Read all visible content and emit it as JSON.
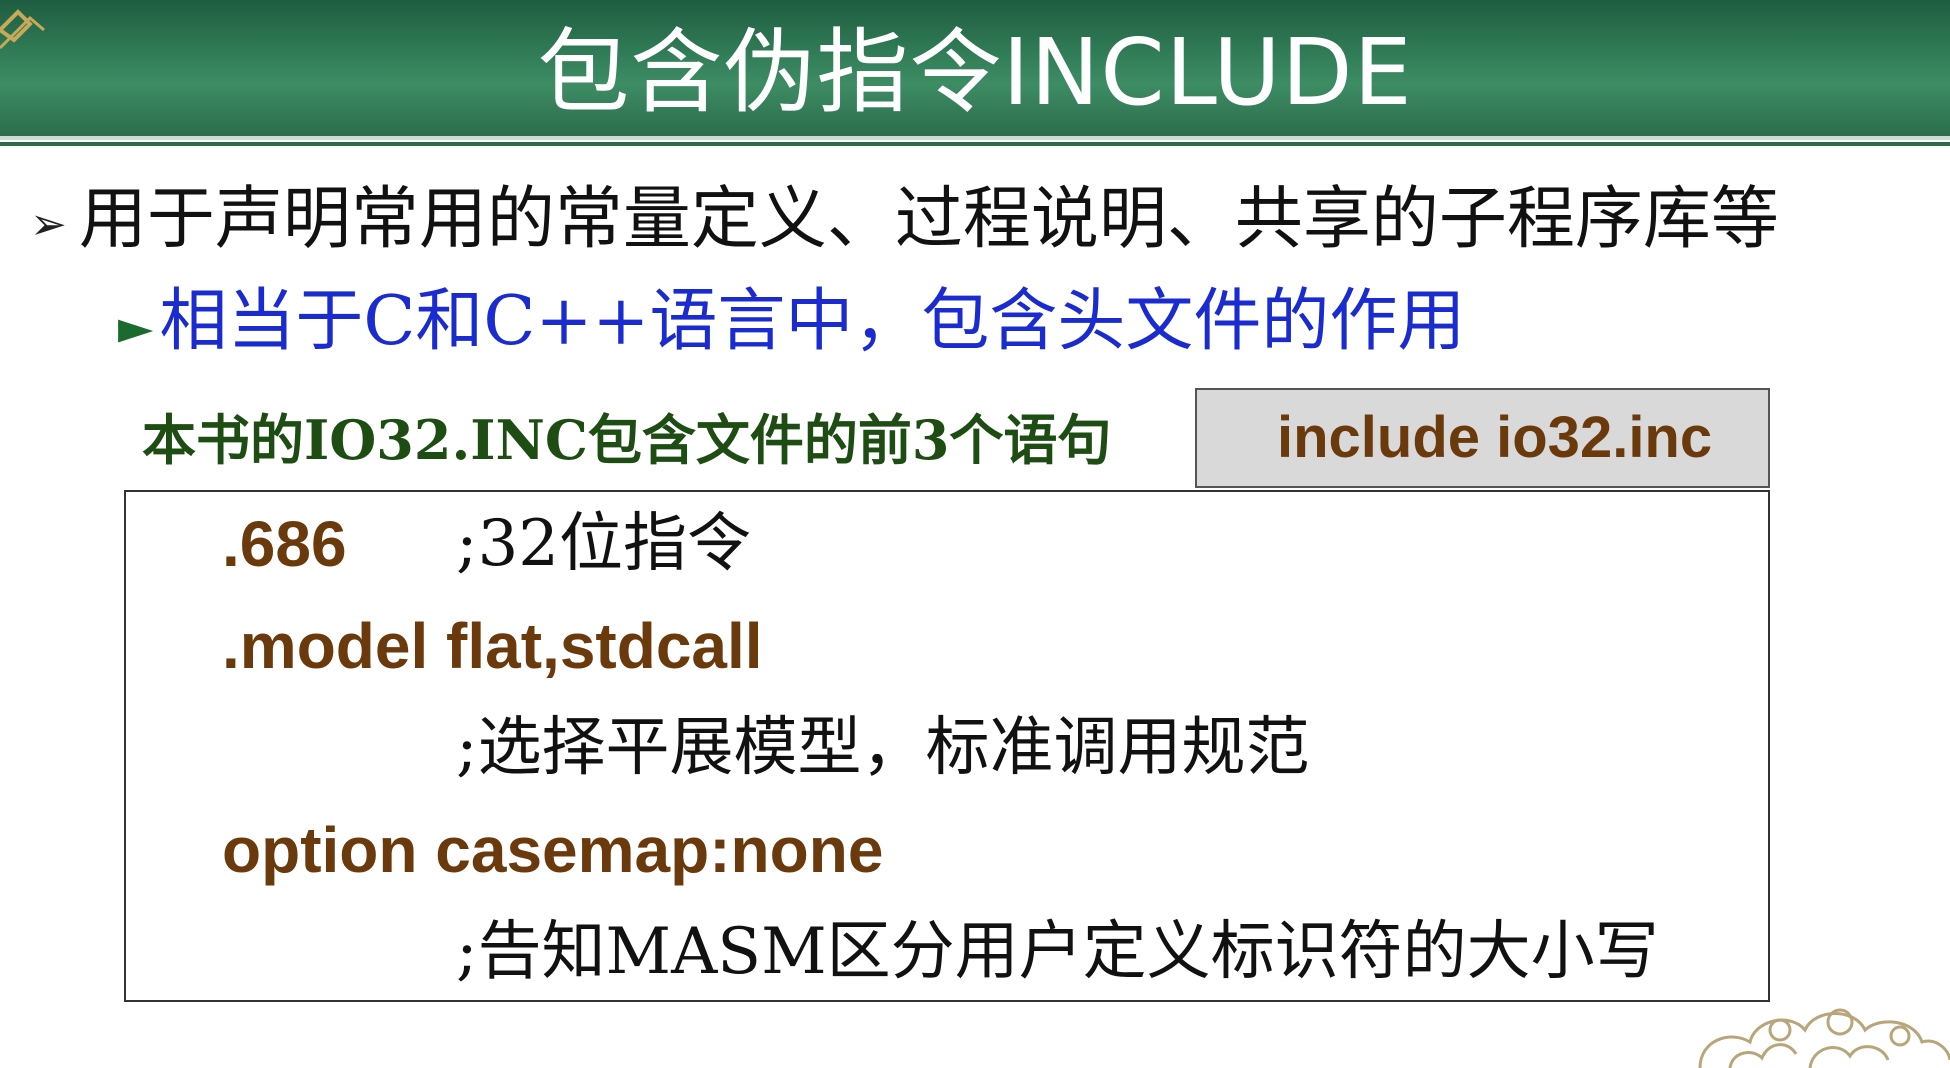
{
  "slide": {
    "title": "包含伪指令INCLUDE",
    "bullet1": {
      "marker": "➢",
      "text": "用于声明常用的常量定义、过程说明、共享的子程序库等"
    },
    "bullet2": {
      "marker": "►",
      "text": "相当于C和C++语言中，包含头文件的作用"
    },
    "caption": "本书的IO32.INC包含文件的前3个语句",
    "include_tab": "include io32.inc",
    "code": [
      {
        "keyword": ".686",
        "comment": ";32位指令"
      },
      {
        "keyword": ".model flat,stdcall",
        "comment": ""
      },
      {
        "keyword": "",
        "comment": ";选择平展模型，标准调用规范"
      },
      {
        "keyword": "option casemap:none",
        "comment": ""
      },
      {
        "keyword": "",
        "comment": ";告知MASM区分用户定义标识符的大小写"
      }
    ]
  },
  "colors": {
    "banner_green": "#2f7a55",
    "bullet2_blue": "#1a2bd0",
    "caption_green": "#1d4d12",
    "keyword_brown": "#6b3a0c"
  }
}
